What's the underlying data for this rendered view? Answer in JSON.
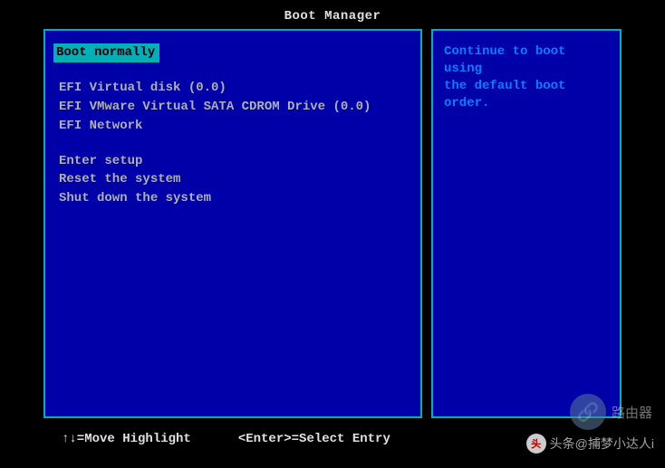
{
  "title": "Boot Manager",
  "menu": {
    "selected": "Boot normally",
    "group1": [
      "EFI Virtual disk (0.0)",
      "EFI VMware Virtual SATA CDROM Drive (0.0)",
      "EFI Network"
    ],
    "group2": [
      "Enter setup",
      "Reset the system",
      "Shut down the system"
    ]
  },
  "help": {
    "line1": "Continue to boot using",
    "line2": "the default boot order."
  },
  "footer": {
    "hint_move": "↑↓=Move Highlight",
    "hint_select": "<Enter>=Select Entry"
  },
  "watermarks": {
    "top": "路由器",
    "bottom_label": "头条",
    "bottom_user": "@捕梦小达人i"
  }
}
